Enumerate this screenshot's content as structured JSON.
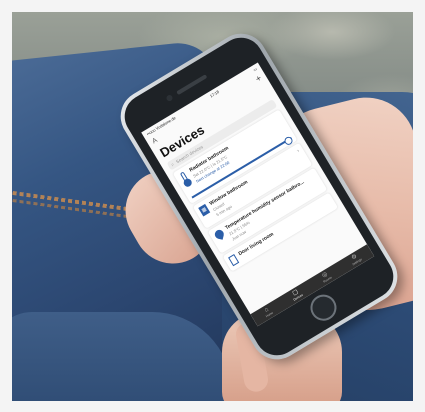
{
  "screen": {
    "status": {
      "carrier": "••ooo Vodafone.de",
      "time": "17:18",
      "battery": "▭"
    },
    "topbar": {
      "left_icon": "A",
      "add_icon": "+"
    },
    "title": "Devices",
    "search_placeholder": "Search devices",
    "devices": [
      {
        "name": "Radiator bathroom",
        "line1": "Set 22.0°C | Is 21.5°C",
        "line2": "Next change at 22:00"
      },
      {
        "name": "Window bathroom",
        "line1": "Closed",
        "line2": "5 min ago"
      },
      {
        "name": "Temperature humidity sensor bathro...",
        "line1": "21.5°C | 55%",
        "line2": "Just now"
      },
      {
        "name": "Door living room",
        "line1": "",
        "line2": ""
      }
    ],
    "tabs": [
      {
        "label": "Home",
        "glyph": "⌂"
      },
      {
        "label": "Devices",
        "glyph": "▢"
      },
      {
        "label": "Rooms",
        "glyph": "◎"
      },
      {
        "label": "Settings",
        "glyph": "⚙"
      }
    ]
  },
  "colors": {
    "accent": "#2b5ea8",
    "jeans": "#30507c",
    "skin": "#e7bba9"
  }
}
